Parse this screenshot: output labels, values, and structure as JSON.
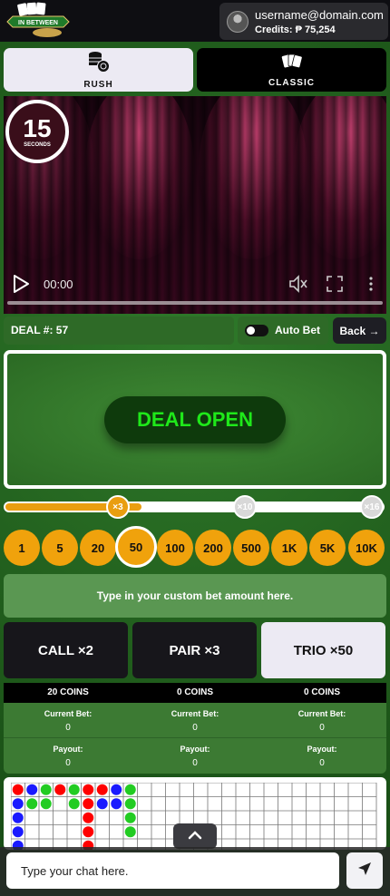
{
  "header": {
    "logo_text": "IN BETWEEN",
    "username": "username@domain.com",
    "credits": "Credits: ₱ 75,254"
  },
  "modes": [
    {
      "label": "RUSH",
      "icon": "coin-stack-icon",
      "active": true
    },
    {
      "label": "CLASSIC",
      "icon": "cards-icon",
      "active": false
    }
  ],
  "video": {
    "timer_value": "15",
    "timer_unit": "SECONDS",
    "time": "00:00",
    "progress": 0
  },
  "deal": {
    "label": "DEAL #: 57",
    "auto_bet_label": "Auto Bet",
    "auto_bet_on": false,
    "back_label": "Back →"
  },
  "table": {
    "status": "DEAL OPEN"
  },
  "multiplier": {
    "nodes": [
      "×3",
      "×10",
      "×16"
    ],
    "progress_fraction": 0.36
  },
  "chips": [
    "1",
    "5",
    "20",
    "50",
    "100",
    "200",
    "500",
    "1K",
    "5K",
    "10K"
  ],
  "selected_chip": "50",
  "custom_bet_placeholder": "Type in your custom bet amount here.",
  "bets": {
    "call": "CALL ×2",
    "pair": "PAIR  ×3",
    "trio": "TRIO ×50"
  },
  "coins": [
    {
      "amount": "20 COINS",
      "current_bet_label": "Current Bet:",
      "current_bet": "0",
      "payout_label": "Payout:",
      "payout": "0"
    },
    {
      "amount": "0 COINS",
      "current_bet_label": "Current Bet:",
      "current_bet": "0",
      "payout_label": "Payout:",
      "payout": "0"
    },
    {
      "amount": "0 COINS",
      "current_bet_label": "Current Bet:",
      "current_bet": "0",
      "payout_label": "Payout:",
      "payout": "0"
    }
  ],
  "road": {
    "colors": {
      "r": "#ff0000",
      "b": "#1a1aff",
      "g": "#22cc22"
    },
    "columns": [
      [
        "r",
        "b",
        "b",
        "b",
        "b"
      ],
      [
        "b",
        "g"
      ],
      [
        "g",
        "g"
      ],
      [
        "r"
      ],
      [
        "g",
        "g"
      ],
      [
        "r",
        "r",
        "r",
        "r",
        "r"
      ],
      [
        "r",
        "b"
      ],
      [
        "b",
        "b"
      ],
      [
        "g",
        "g",
        "g",
        "g"
      ]
    ]
  },
  "chat": {
    "placeholder": "Type your chat here."
  },
  "colors": {
    "felt": "#2b6a24",
    "chip": "#f0a20c",
    "deal_open_text": "#1fe81a"
  }
}
